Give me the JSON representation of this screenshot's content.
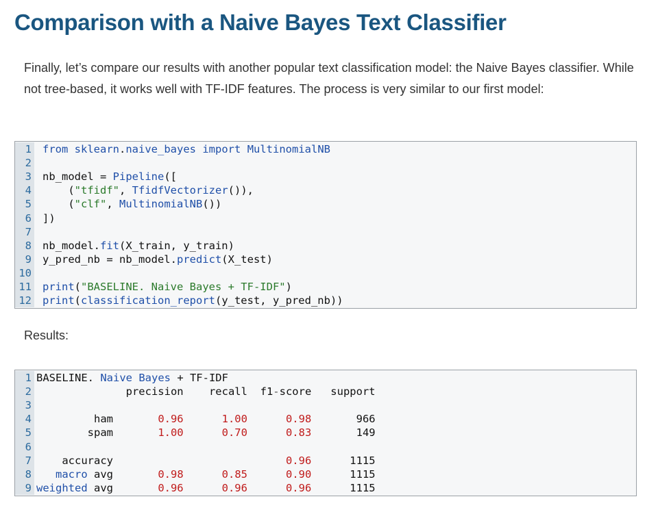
{
  "title": "Comparison with a Naive Bayes Text Classifier",
  "intro": "Finally, let’s compare our results with another popular text classification model: the Naive Bayes classifier. While not tree-based, it works well with TF-IDF features. The process is very similar to our first model:",
  "code_block": {
    "line_numbers": [
      "1",
      "2",
      "3",
      "4",
      "5",
      "6",
      "7",
      "8",
      "9",
      "10",
      "11",
      "12"
    ],
    "lines": [
      "from sklearn.naive_bayes import MultinomialNB",
      "",
      "nb_model = Pipeline([",
      "    (\"tfidf\", TfidfVectorizer()),",
      "    (\"clf\", MultinomialNB())",
      "])",
      "",
      "nb_model.fit(X_train, y_train)",
      "y_pred_nb = nb_model.predict(X_test)",
      "",
      "print(\"BASELINE. Naive Bayes + TF-IDF\")",
      "print(classification_report(y_test, y_pred_nb))"
    ]
  },
  "results_label": "Results:",
  "results_block": {
    "line_numbers": [
      "1",
      "2",
      "3",
      "4",
      "5",
      "6",
      "7",
      "8",
      "9"
    ],
    "lines": [
      "BASELINE. Naive Bayes + TF-IDF",
      "              precision    recall  f1-score   support",
      "",
      "         ham       0.96      1.00      0.98       966",
      "        spam       1.00      0.70      0.83       149",
      "",
      "    accuracy                           0.96      1115",
      "   macro avg       0.98      0.85      0.90      1115",
      "weighted avg       0.96      0.96      0.96      1115"
    ]
  },
  "colors": {
    "title": "#1a5680",
    "keyword": "#1f4fa8",
    "string": "#2b7a2b",
    "number": "#c01b1b",
    "gutter_bg": "#dde3e8",
    "code_bg": "#f6f7f8"
  }
}
